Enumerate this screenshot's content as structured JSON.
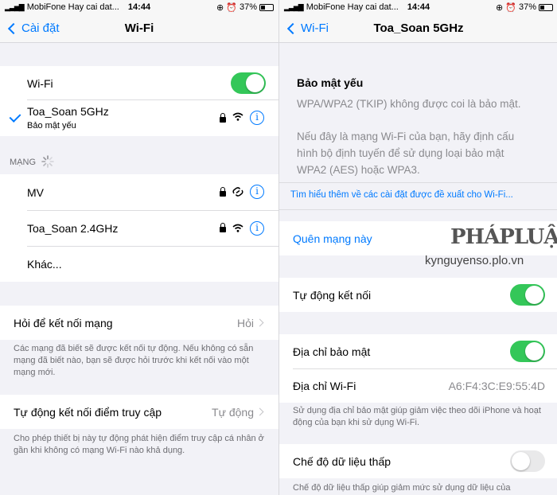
{
  "status": {
    "carrier": "MobiFone Hay cai dat...",
    "time": "14:44",
    "battery": "37%",
    "battery_level": 0.37
  },
  "left": {
    "nav": {
      "back_label": "Cài đặt",
      "title": "Wi-Fi"
    },
    "wifi_toggle_label": "Wi-Fi",
    "wifi_on": true,
    "connected": {
      "name": "Toa_Soan 5GHz",
      "sub": "Bảo mật yếu"
    },
    "networks_header": "MẠNG",
    "networks": [
      {
        "name": "MV",
        "secured": true,
        "icon": "link-icon"
      },
      {
        "name": "Toa_Soan 2.4GHz",
        "secured": true,
        "icon": "wifi-icon"
      }
    ],
    "other_label": "Khác...",
    "ask_join": {
      "label": "Hỏi để kết nối mạng",
      "value": "Hỏi"
    },
    "ask_join_footer": "Các mạng đã biết sẽ được kết nối tự động. Nếu không có sẵn mạng đã biết nào, bạn sẽ được hỏi trước khi kết nối vào một mạng mới.",
    "auto_hotspot": {
      "label": "Tự động kết nối điểm truy cập",
      "value": "Tự động"
    },
    "auto_hotspot_footer": "Cho phép thiết bị này tự động phát hiện điểm truy cập cá nhân ở gần khi không có mạng Wi-Fi nào khả dụng."
  },
  "right": {
    "nav": {
      "back_label": "Wi-Fi",
      "title": "Toa_Soan 5GHz"
    },
    "warning_title": "Bảo mật yếu",
    "warning_text_1": "WPA/WPA2 (TKIP) không được coi là bảo mật.",
    "warning_text_2": "Nếu đây là mạng Wi-Fi của bạn, hãy định cấu hình bộ định tuyến để sử dụng loại bảo mật WPA2 (AES) hoặc WPA3.",
    "learn_more": "Tìm hiểu thêm về các cài đặt được đề xuất cho Wi-Fi...",
    "forget_label": "Quên mạng này",
    "auto_join_label": "Tự động kết nối",
    "auto_join_on": true,
    "private_address_label": "Địa chỉ bảo mật",
    "private_address_on": true,
    "wifi_address_label": "Địa chỉ Wi-Fi",
    "wifi_address_value": "A6:F4:3C:E9:55:4D",
    "private_footer": "Sử dụng địa chỉ bảo mật giúp giảm việc theo dõi iPhone và hoạt động của bạn khi sử dụng Wi-Fi.",
    "low_data_label": "Chế độ dữ liệu thấp",
    "low_data_on": false,
    "low_data_footer": "Chế độ dữ liệu thấp giúp giảm mức sử dụng dữ liệu của"
  },
  "watermark": {
    "logo": "PHÁPLUẬT",
    "url": "kynguyenso.plo.vn"
  },
  "colors": {
    "accent": "#007aff",
    "toggle_on": "#34c759",
    "background": "#f2f2f7"
  }
}
